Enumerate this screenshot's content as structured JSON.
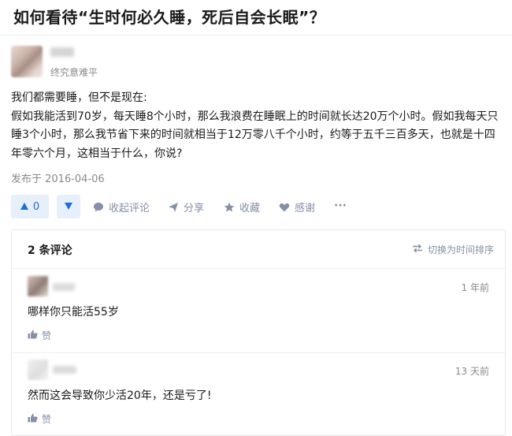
{
  "question": {
    "title": "如何看待“生时何必久睡，死后自会长眠”？"
  },
  "author": {
    "bio": "终究意难平"
  },
  "answer": {
    "paragraphs": [
      "我们都需要睡，但不是现在:",
      "假如我能活到70岁，每天睡8个小时，那么我浪费在睡眠上的时间就长达20万个小时。假如我每天只睡3个小时，那么我节省下来的时间就相当于12万零八千个小时，约等于五千三百多天，也就是十四年零六个月，这相当于什么，你说?"
    ],
    "published": "发布于 2016-04-06"
  },
  "actions": {
    "upvote_count": "0",
    "collapse_comments": "收起评论",
    "share": "分享",
    "favorite": "收藏",
    "thanks": "感谢",
    "more": "···"
  },
  "comments": {
    "count_label": "2 条评论",
    "sort_label": "切换为时间排序",
    "items": [
      {
        "time": "1 年前",
        "text": "哪样你只能活55岁",
        "like": "赞"
      },
      {
        "time": "13 天前",
        "text": "然而这会导致你少活20年，还是亏了!",
        "like": "赞"
      }
    ]
  },
  "colors": {
    "accent": "#1b6fd6",
    "action_gray": "#8590a6",
    "vote_bg": "#e6effa"
  },
  "icons": [
    "caret-up-icon",
    "caret-down-icon",
    "comment-bubble-icon",
    "share-plane-icon",
    "star-icon",
    "heart-icon",
    "more-dots-icon",
    "sort-swap-icon",
    "thumb-up-icon"
  ]
}
